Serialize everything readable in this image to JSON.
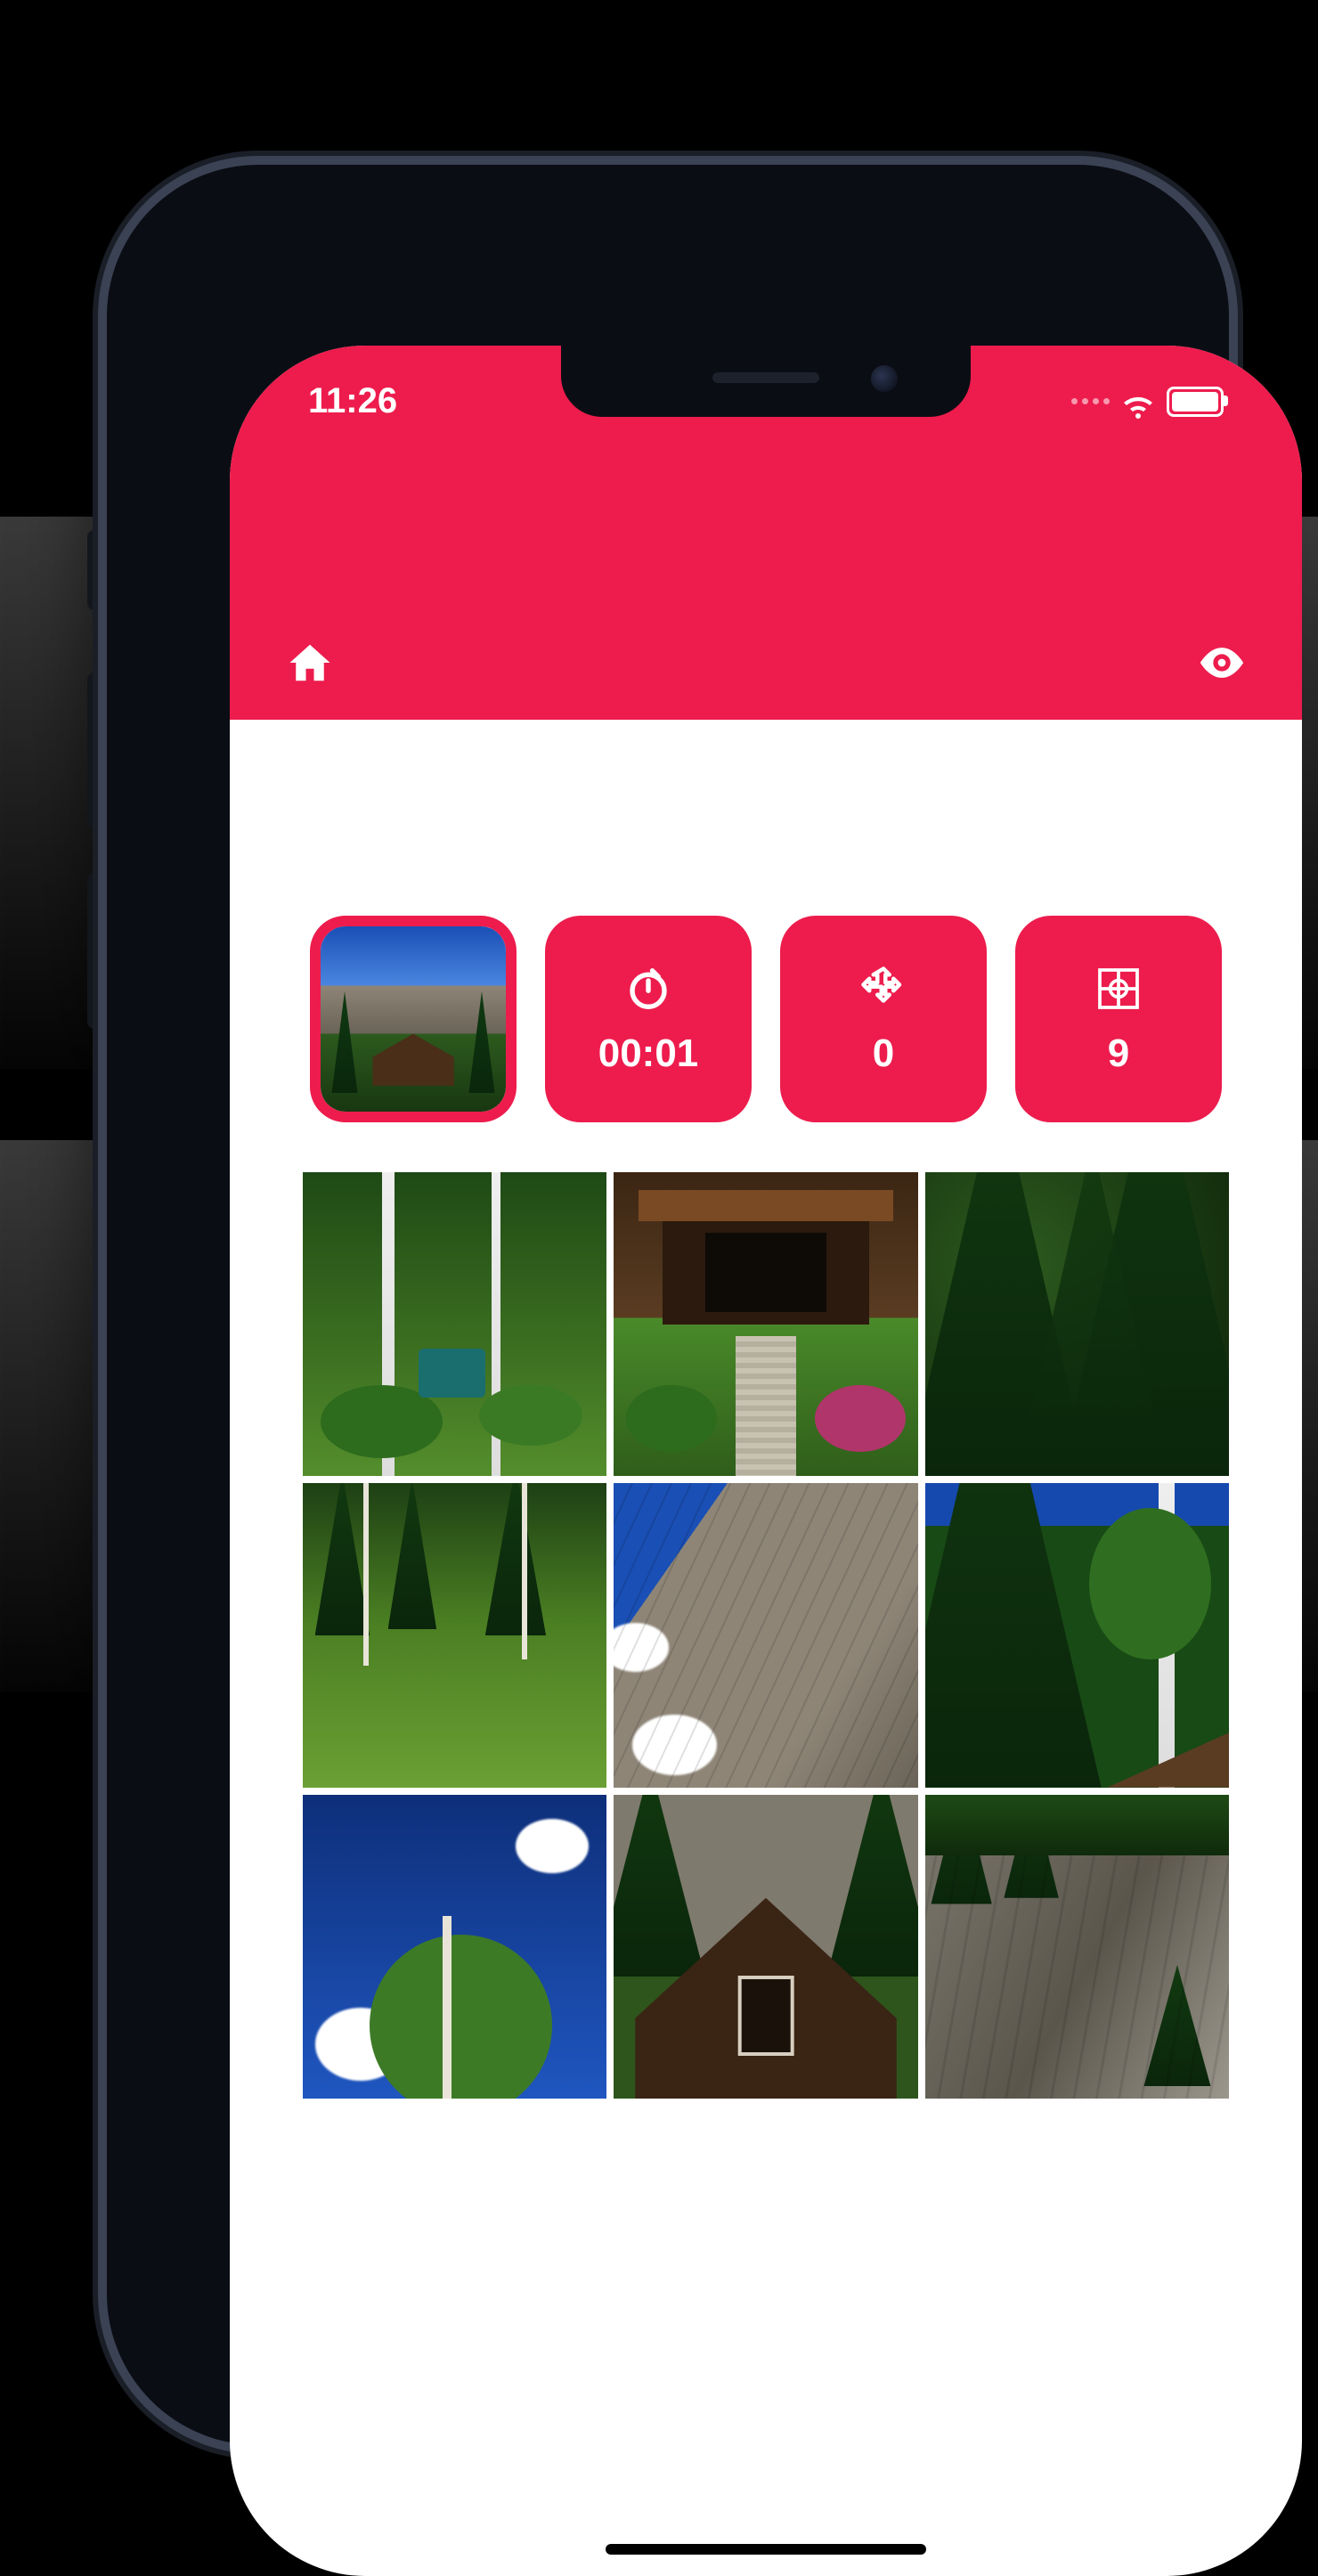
{
  "status": {
    "time": "11:26"
  },
  "header": {
    "home_icon": "home-icon",
    "preview_icon": "eye-icon"
  },
  "info": {
    "timer_icon": "timer-icon",
    "timer_value": "00:01",
    "moves_icon": "move-icon",
    "moves_value": "0",
    "pieces_icon": "grid-icon",
    "pieces_value": "9"
  },
  "puzzle": {
    "grid": 3,
    "tiles": [
      "yard-birches",
      "cabin-porch",
      "dark-spruce",
      "meadow-trees",
      "rock-cliff",
      "fir-birch-sky",
      "sky-aspen",
      "cabin-gable",
      "mountainside"
    ]
  }
}
